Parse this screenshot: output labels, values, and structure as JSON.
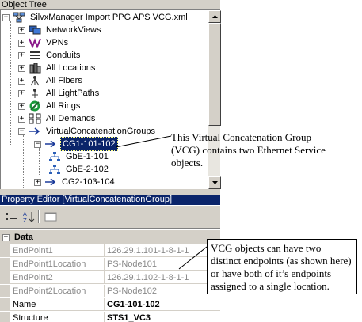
{
  "object_tree": {
    "title": "Object Tree",
    "items": [
      {
        "label": "SilvxManager Import PPG APS VCG.xml",
        "icon": "network-root-icon",
        "expander": "−"
      },
      {
        "label": "NetworkViews",
        "icon": "network-views-icon",
        "expander": "+"
      },
      {
        "label": "VPNs",
        "icon": "vpn-icon",
        "expander": "+"
      },
      {
        "label": "Conduits",
        "icon": "conduit-icon",
        "expander": "+"
      },
      {
        "label": "All Locations",
        "icon": "locations-icon",
        "expander": "+"
      },
      {
        "label": "All Fibers",
        "icon": "fibers-icon",
        "expander": "+"
      },
      {
        "label": "All LightPaths",
        "icon": "lightpaths-icon",
        "expander": "+"
      },
      {
        "label": "All Rings",
        "icon": "rings-icon",
        "expander": "+"
      },
      {
        "label": "All Demands",
        "icon": "demands-icon",
        "expander": "+"
      },
      {
        "label": "VirtualConcatenationGroups",
        "icon": "vcg-arrow-icon",
        "expander": "−"
      },
      {
        "label": "CG1-101-102",
        "icon": "vcg-arrow-icon",
        "expander": "−"
      },
      {
        "label": "GbE-1-101",
        "icon": "ethernet-service-icon",
        "expander": ""
      },
      {
        "label": "GbE-2-102",
        "icon": "ethernet-service-icon",
        "expander": ""
      },
      {
        "label": "CG2-103-104",
        "icon": "vcg-arrow-icon",
        "expander": "+"
      }
    ]
  },
  "property_editor": {
    "title": "Property  Editor  [VirtualConcatenationGroup]",
    "toolbar": {
      "categorized": "categorized-icon",
      "alphabetical": "alphabetical-sort-icon",
      "pages": "property-pages-icon"
    },
    "category": {
      "label": "Data",
      "expander": "−"
    },
    "rows": [
      {
        "name": "EndPoint1",
        "value": "126.29.1.101-1-8-1-1"
      },
      {
        "name": "EndPoint1Location",
        "value": "PS-Node101"
      },
      {
        "name": "EndPoint2",
        "value": "126.29.1.102-1-8-1-1"
      },
      {
        "name": "EndPoint2Location",
        "value": "PS-Node102"
      },
      {
        "name": "Name",
        "value": "CG1-101-102"
      },
      {
        "name": "Structure",
        "value": "STS1_VC3"
      }
    ]
  },
  "callouts": {
    "vcg_note": "This Virtual Concatenation Group (VCG) contains two Ethernet Service objects.",
    "endpoint_note": "VCG objects can have two distinct endpoints (as shown here) or have both of it’s endpoints assigned to a single location."
  },
  "colors": {
    "selection": "#0a246a",
    "chrome": "#d4d0c8",
    "dim_text": "#8a8a8a"
  }
}
